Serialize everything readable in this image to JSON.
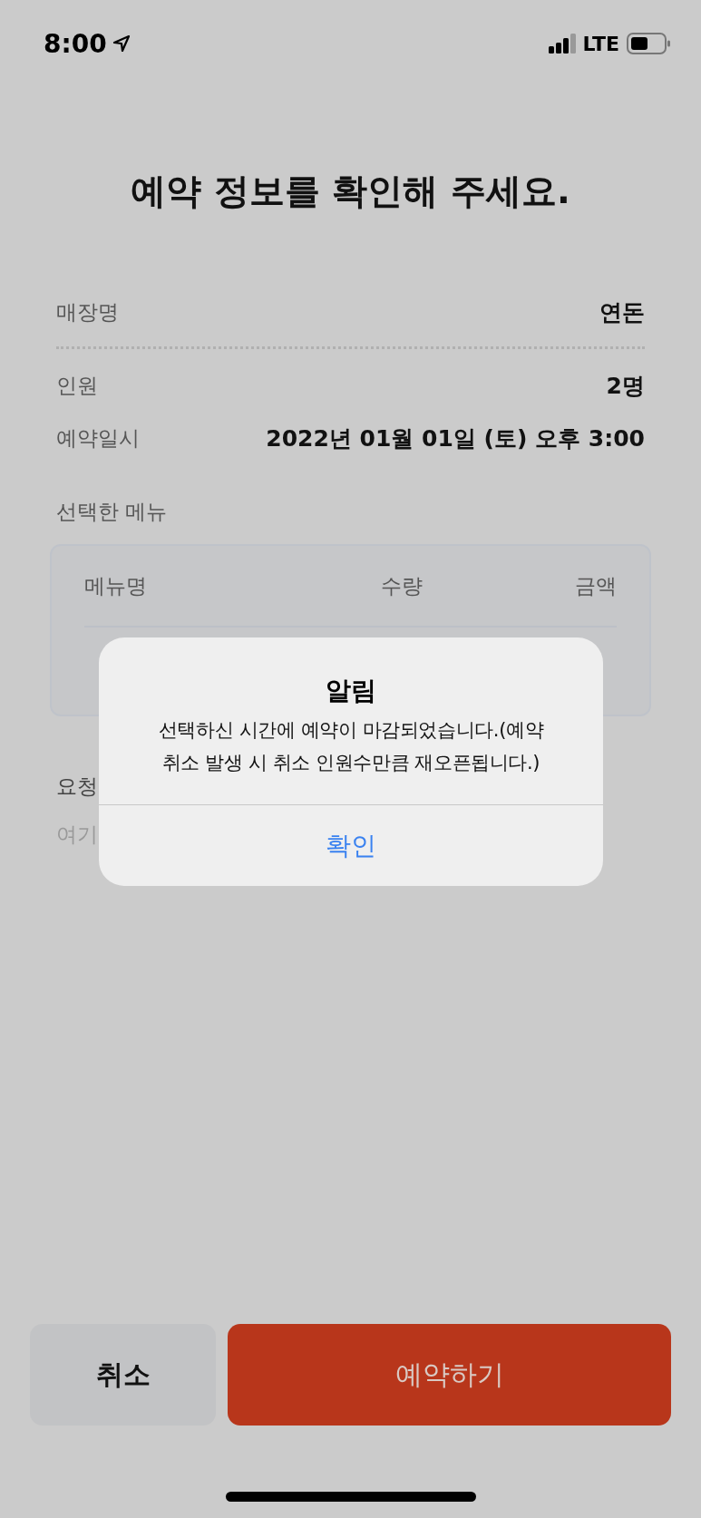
{
  "status_bar": {
    "time": "8:00",
    "network": "LTE"
  },
  "title": "예약 정보를 확인해 주세요.",
  "info": [
    {
      "label": "매장명",
      "value": "연돈",
      "divider": true
    },
    {
      "label": "인원",
      "value": "2명",
      "divider": false
    },
    {
      "label": "예약일시",
      "value": "2022년 01월 01일 (토) 오후 3:00",
      "divider": false
    }
  ],
  "menu_section": {
    "heading": "선택한 메뉴",
    "columns": [
      "메뉴명",
      "수량",
      "금액"
    ]
  },
  "request": {
    "heading": "요청",
    "placeholder": "여기"
  },
  "buttons": [
    {
      "kind": "secondary",
      "label": "취소"
    },
    {
      "kind": "primary",
      "label": "예약하기"
    }
  ],
  "alert": {
    "title": "알림",
    "message": "선택하신 시간에 예약이 마감되었습니다.(예약 취소 발생 시 취소 인원수만큼 재오픈됩니다.)",
    "action": "확인"
  }
}
